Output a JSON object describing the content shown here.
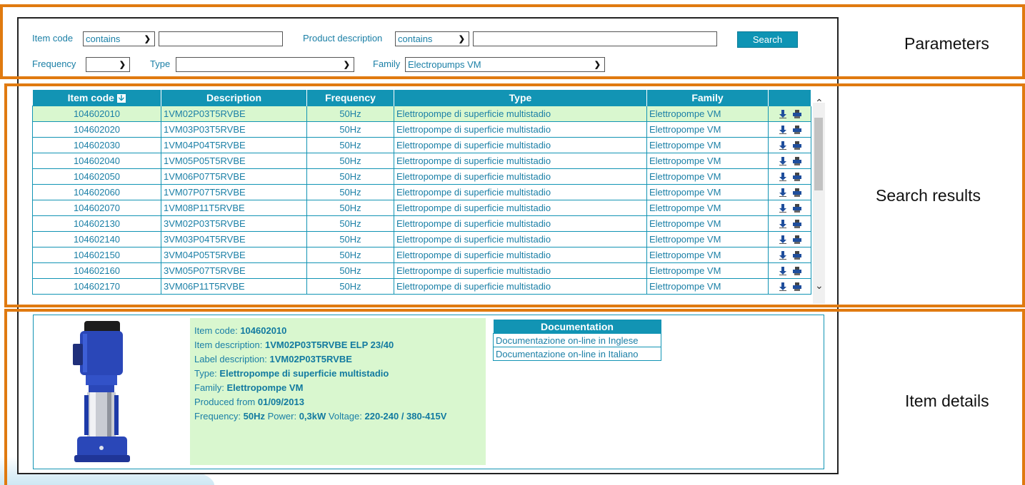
{
  "params": {
    "item_code_label": "Item code",
    "item_code_op": "contains",
    "item_code_value": "",
    "desc_label": "Product description",
    "desc_op": "contains",
    "desc_value": "",
    "search_label": "Search",
    "frequency_label": "Frequency",
    "frequency_value": "",
    "type_label": "Type",
    "type_value": "",
    "family_label": "Family",
    "family_value": "Electropumps VM"
  },
  "table": {
    "headers": [
      "Item code",
      "Description",
      "Frequency",
      "Type",
      "Family",
      ""
    ],
    "rows": [
      {
        "code": "104602010",
        "desc": "1VM02P03T5RVBE",
        "freq": "50Hz",
        "type": "Elettropompe di superficie multistadio",
        "family": "Elettropompe VM"
      },
      {
        "code": "104602020",
        "desc": "1VM03P03T5RVBE",
        "freq": "50Hz",
        "type": "Elettropompe di superficie multistadio",
        "family": "Elettropompe VM"
      },
      {
        "code": "104602030",
        "desc": "1VM04P04T5RVBE",
        "freq": "50Hz",
        "type": "Elettropompe di superficie multistadio",
        "family": "Elettropompe VM"
      },
      {
        "code": "104602040",
        "desc": "1VM05P05T5RVBE",
        "freq": "50Hz",
        "type": "Elettropompe di superficie multistadio",
        "family": "Elettropompe VM"
      },
      {
        "code": "104602050",
        "desc": "1VM06P07T5RVBE",
        "freq": "50Hz",
        "type": "Elettropompe di superficie multistadio",
        "family": "Elettropompe VM"
      },
      {
        "code": "104602060",
        "desc": "1VM07P07T5RVBE",
        "freq": "50Hz",
        "type": "Elettropompe di superficie multistadio",
        "family": "Elettropompe VM"
      },
      {
        "code": "104602070",
        "desc": "1VM08P11T5RVBE",
        "freq": "50Hz",
        "type": "Elettropompe di superficie multistadio",
        "family": "Elettropompe VM"
      },
      {
        "code": "104602130",
        "desc": "3VM02P03T5RVBE",
        "freq": "50Hz",
        "type": "Elettropompe di superficie multistadio",
        "family": "Elettropompe VM"
      },
      {
        "code": "104602140",
        "desc": "3VM03P04T5RVBE",
        "freq": "50Hz",
        "type": "Elettropompe di superficie multistadio",
        "family": "Elettropompe VM"
      },
      {
        "code": "104602150",
        "desc": "3VM04P05T5RVBE",
        "freq": "50Hz",
        "type": "Elettropompe di superficie multistadio",
        "family": "Elettropompe VM"
      },
      {
        "code": "104602160",
        "desc": "3VM05P07T5RVBE",
        "freq": "50Hz",
        "type": "Elettropompe di superficie multistadio",
        "family": "Elettropompe VM"
      },
      {
        "code": "104602170",
        "desc": "3VM06P11T5RVBE",
        "freq": "50Hz",
        "type": "Elettropompe di superficie multistadio",
        "family": "Elettropompe VM"
      }
    ],
    "selected_index": 0
  },
  "details": {
    "item_code_label": "Item code: ",
    "item_code": "104602010",
    "item_desc_label": "Item description: ",
    "item_desc": "1VM02P03T5RVBE ELP 23/40",
    "label_desc_label": "Label description: ",
    "label_desc": "1VM02P03T5RVBE",
    "type_label": "Type: ",
    "type": "Elettropompe di superficie multistadio",
    "family_label": "Family: ",
    "family": "Elettropompe VM",
    "produced_label": "Produced from ",
    "produced": "01/09/2013",
    "frequency_label": "Frequency: ",
    "frequency": "50Hz",
    "power_label": " Power: ",
    "power": "0,3kW",
    "voltage_label": " Voltage: ",
    "voltage": "220-240 / 380-415V"
  },
  "documentation": {
    "header": "Documentation",
    "links": [
      "Documentazione on-line in Inglese",
      "Documentazione on-line in Italiano"
    ]
  },
  "annotations": {
    "parameters": "Parameters",
    "search_results": "Search results",
    "item_details": "Item details"
  },
  "colors": {
    "accent": "#1294b4",
    "annotation": "#e07a10",
    "selected_row": "#d9f7cf"
  }
}
